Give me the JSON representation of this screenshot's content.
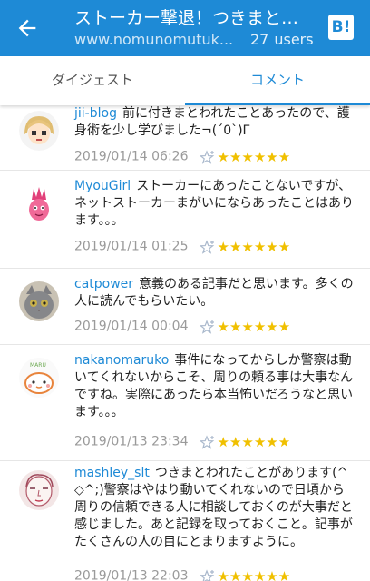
{
  "header": {
    "title": "ストーカー撃退！つきまと…",
    "url": "www.nomunomutuk...",
    "user_count": "27",
    "users_label": "users",
    "logo": "B!",
    "colors": {
      "bar": "#1e8ad6",
      "star": "#f0c000",
      "link": "#1e8ad6"
    }
  },
  "tabs": [
    {
      "label": "ダイジェスト",
      "active": false
    },
    {
      "label": "コメント",
      "active": true
    }
  ],
  "comments": [
    {
      "user": "jii-blog",
      "text": "前に付きまとわれたことあったので、護身術を少し学びました¬(´0`)Γ",
      "date": "2019/01/14 06:26",
      "stars": "★★★★★★",
      "avatar": "cartoon-girl-avatar"
    },
    {
      "user": "MyouGirl",
      "text": "ストーカーにあったことないですが、ネットストーカーまがいにならあったことはあります。。。",
      "date": "2019/01/14 01:25",
      "stars": "★★★★★★",
      "avatar": "pink-creature-avatar"
    },
    {
      "user": "catpower",
      "text": "意義のある記事だと思います。多くの人に読んでもらいたい。",
      "date": "2019/01/14 00:04",
      "stars": "★★★★★★",
      "avatar": "gray-cat-avatar"
    },
    {
      "user": "nakanomaruko",
      "text": "事件になってからしか警察は動いてくれないからこそ、周りの頼る事は大事なんですね。実際にあったら本当怖いだろうなと思います。。。",
      "date": "2019/01/13 23:34",
      "stars": "★★★★★★",
      "avatar": "maru-character-avatar"
    },
    {
      "user": "mashley_slt",
      "text": "つきまとわれたことがあります(^◇^;)警察はやはり動いてくれないので日頃から周りの信頼できる人に相談しておくのが大事だと感じました。あと記録を取っておくこと。記事がたくさんの人の目にとまりますように。",
      "date": "2019/01/13 22:03",
      "stars": "★★★★★★",
      "avatar": "sketch-face-avatar"
    }
  ]
}
